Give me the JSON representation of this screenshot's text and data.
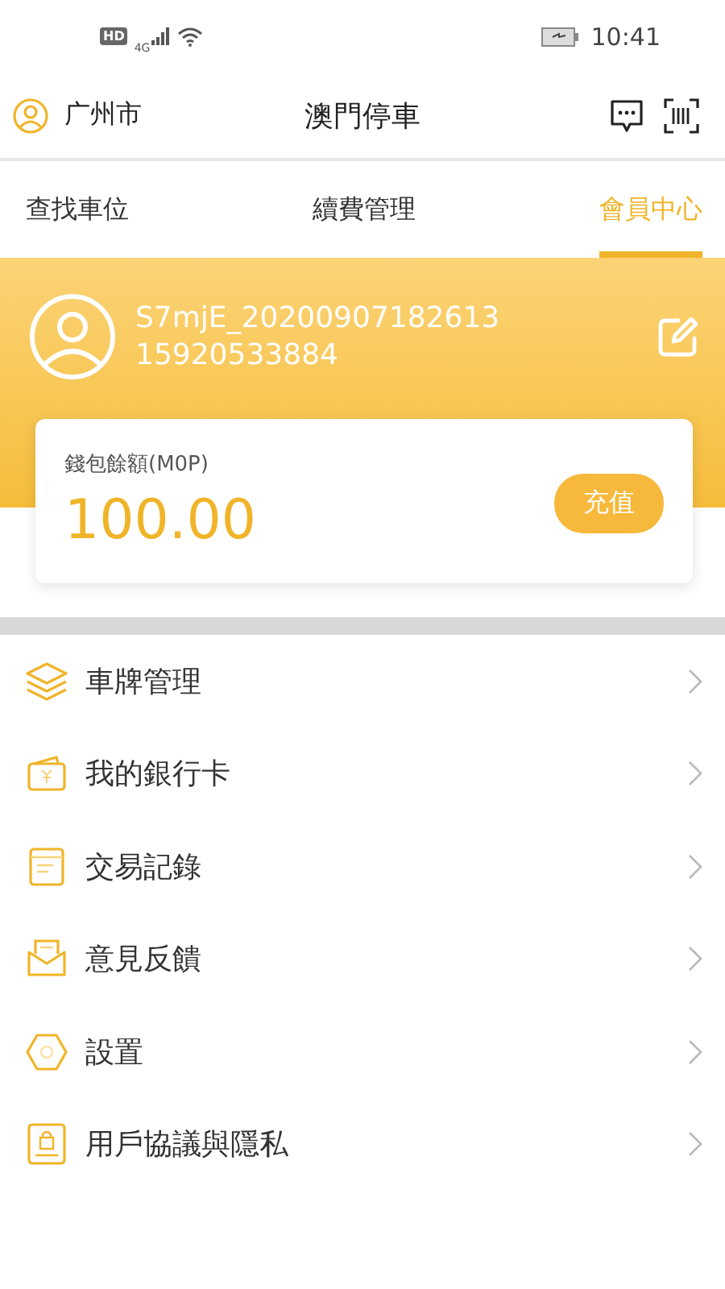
{
  "status_bar": {
    "hd": "HD",
    "network": "4G",
    "time": "10:41"
  },
  "header": {
    "city": "广州市",
    "title": "澳門停車"
  },
  "tabs": [
    {
      "label": "查找車位",
      "selected": false
    },
    {
      "label": "續費管理",
      "selected": false
    },
    {
      "label": "會員中心",
      "selected": true
    }
  ],
  "profile": {
    "username": "S7mjE_20200907182613",
    "phone": "15920533884"
  },
  "wallet": {
    "label": "錢包餘額(M0P)",
    "balance": "100.00",
    "button": "充值"
  },
  "menu": [
    {
      "kind": "layers",
      "label": "車牌管理"
    },
    {
      "kind": "wallet",
      "label": "我的銀行卡"
    },
    {
      "kind": "receipt",
      "label": "交易記錄"
    },
    {
      "kind": "mail",
      "label": "意見反饋"
    },
    {
      "kind": "hexagon",
      "label": "設置"
    },
    {
      "kind": "lock",
      "label": "用戶協議與隱私"
    }
  ]
}
